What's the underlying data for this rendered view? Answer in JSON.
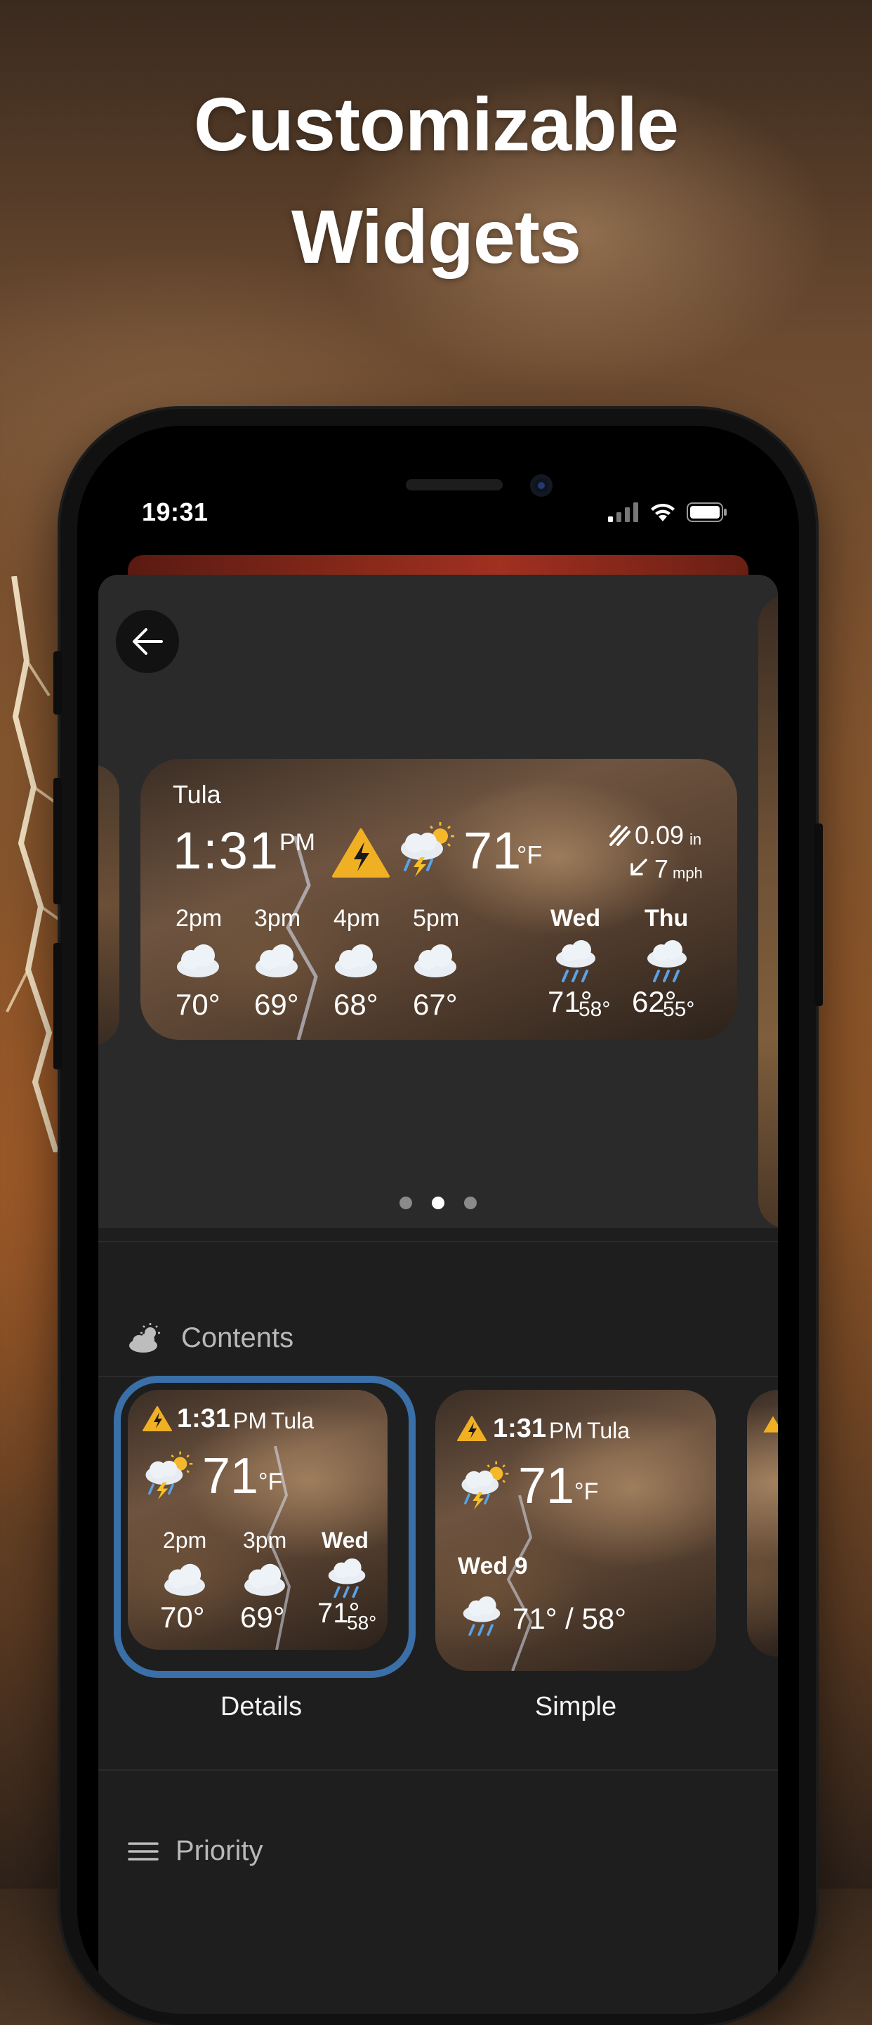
{
  "headline": {
    "line1": "Customizable",
    "line2": "Widgets"
  },
  "status_bar": {
    "time": "19:31",
    "icons": [
      "cellular-signal-icon",
      "wifi-icon",
      "battery-icon"
    ]
  },
  "nav": {
    "back_icon": "arrow-left-icon"
  },
  "featured_widget": {
    "location": "Tula",
    "time": "1:31",
    "ampm": "PM",
    "alert_icon": "lightning-warning-icon",
    "condition_icon": "thunderstorm-partly-sunny-icon",
    "temperature": "71",
    "temp_unit": "°F",
    "precip_amount": "0.09",
    "precip_unit": "in",
    "wind_speed": "7",
    "wind_unit": "mph",
    "hourly": [
      {
        "label": "2pm",
        "icon": "cloud-icon",
        "temp": "70°"
      },
      {
        "label": "3pm",
        "icon": "cloud-icon",
        "temp": "69°"
      },
      {
        "label": "4pm",
        "icon": "cloud-icon",
        "temp": "68°"
      },
      {
        "label": "5pm",
        "icon": "cloud-icon",
        "temp": "67°"
      }
    ],
    "daily": [
      {
        "label": "Wed",
        "icon": "rain-cloud-icon",
        "high": "71°",
        "low": "58°"
      },
      {
        "label": "Thu",
        "icon": "rain-cloud-icon",
        "high": "62°",
        "low": "55°"
      }
    ]
  },
  "carousel": {
    "page_count": 3,
    "active_page": 2
  },
  "contents_section": {
    "title": "Contents",
    "options": [
      {
        "caption": "Details",
        "selected": true,
        "time": "1:31",
        "ampm": "PM",
        "location": "Tula",
        "temperature": "71",
        "temp_unit": "°F",
        "columns": [
          {
            "label": "2pm",
            "temp": "70°"
          },
          {
            "label": "3pm",
            "temp": "69°"
          },
          {
            "label": "Wed",
            "high": "71°",
            "low": "58°"
          }
        ]
      },
      {
        "caption": "Simple",
        "selected": false,
        "time": "1:31",
        "ampm": "PM",
        "location": "Tula",
        "temperature": "71",
        "temp_unit": "°F",
        "day_label": "Wed 9",
        "range": "71° / 58°"
      }
    ]
  },
  "priority_section": {
    "title": "Priority"
  }
}
